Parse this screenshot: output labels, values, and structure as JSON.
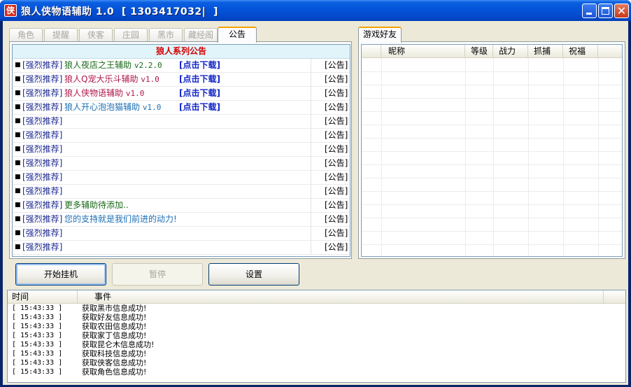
{
  "window": {
    "icon_char": "侠",
    "title": "狼人侠物语辅助 1.0  [ 1303417032|  ]",
    "minimize": "minimize",
    "maximize": "maximize",
    "close_glyph": "✕"
  },
  "tabs": [
    {
      "label": "角色",
      "active": false
    },
    {
      "label": "提醒",
      "active": false
    },
    {
      "label": "侠客",
      "active": false
    },
    {
      "label": "庄园",
      "active": false
    },
    {
      "label": "黑市",
      "active": false
    },
    {
      "label": "藏经阁",
      "active": false
    },
    {
      "label": "公告",
      "active": true
    }
  ],
  "notice": {
    "header": "狼人系列公告",
    "rows": [
      {
        "tag": "[强烈推荐]",
        "name": "狼人夜店之王辅助",
        "version": "v2.2.0",
        "name_color": "#1a6a1a",
        "download": "[点击下载]",
        "kind": "[公告]"
      },
      {
        "tag": "[强烈推荐]",
        "name": "狼人Q宠大乐斗辅助",
        "version": "v1.0",
        "name_color": "#b0174a",
        "download": "[点击下载]",
        "kind": "[公告]"
      },
      {
        "tag": "[强烈推荐]",
        "name": "狼人侠物语辅助",
        "version": "v1.0",
        "name_color": "#b0174a",
        "download": "[点击下载]",
        "kind": "[公告]"
      },
      {
        "tag": "[强烈推荐]",
        "name": "狼人开心泡泡猫辅助",
        "version": "v1.0",
        "name_color": "#1b6fb5",
        "download": "[点击下载]",
        "kind": "[公告]"
      },
      {
        "tag": "[强烈推荐]",
        "name": "",
        "version": "",
        "name_color": "#000",
        "download": "",
        "kind": "[公告]"
      },
      {
        "tag": "[强烈推荐]",
        "name": "",
        "version": "",
        "name_color": "#000",
        "download": "",
        "kind": "[公告]"
      },
      {
        "tag": "[强烈推荐]",
        "name": "",
        "version": "",
        "name_color": "#000",
        "download": "",
        "kind": "[公告]"
      },
      {
        "tag": "[强烈推荐]",
        "name": "",
        "version": "",
        "name_color": "#000",
        "download": "",
        "kind": "[公告]"
      },
      {
        "tag": "[强烈推荐]",
        "name": "",
        "version": "",
        "name_color": "#000",
        "download": "",
        "kind": "[公告]"
      },
      {
        "tag": "[强烈推荐]",
        "name": "",
        "version": "",
        "name_color": "#000",
        "download": "",
        "kind": "[公告]"
      },
      {
        "tag": "[强烈推荐]",
        "name": "更多辅助待添加..",
        "version": "",
        "name_color": "#1a6a1a",
        "download": "",
        "kind": "[公告]"
      },
      {
        "tag": "[强烈推荐]",
        "name": "您的支持就是我们前进的动力!",
        "version": "",
        "name_color": "#1b6fb5",
        "download": "",
        "kind": "[公告]"
      },
      {
        "tag": "[强烈推荐]",
        "name": "",
        "version": "",
        "name_color": "#000",
        "download": "",
        "kind": "[公告]"
      },
      {
        "tag": "[强烈推荐]",
        "name": "",
        "version": "",
        "name_color": "#000",
        "download": "",
        "kind": "[公告]"
      }
    ]
  },
  "friends": {
    "tab": "游戏好友",
    "columns": [
      "昵称",
      "等级",
      "战力",
      "抓捕",
      "祝福"
    ]
  },
  "buttons": {
    "start": "开始挂机",
    "pause": "暂停",
    "settings": "设置"
  },
  "log": {
    "columns": [
      "时间",
      "事件"
    ],
    "rows": [
      {
        "time": "[ 15:43:33 ]",
        "event": "获取黑市信息成功!"
      },
      {
        "time": "[ 15:43:33 ]",
        "event": "获取好友信息成功!"
      },
      {
        "time": "[ 15:43:33 ]",
        "event": "获取农田信息成功!"
      },
      {
        "time": "[ 15:43:33 ]",
        "event": "获取家丁信息成功!"
      },
      {
        "time": "[ 15:43:33 ]",
        "event": "获取昆仑木信息成功!"
      },
      {
        "time": "[ 15:43:33 ]",
        "event": "获取科技信息成功!"
      },
      {
        "time": "[ 15:43:33 ]",
        "event": "获取侠客信息成功!"
      },
      {
        "time": "[ 15:43:33 ]",
        "event": "获取角色信息成功!"
      }
    ]
  }
}
